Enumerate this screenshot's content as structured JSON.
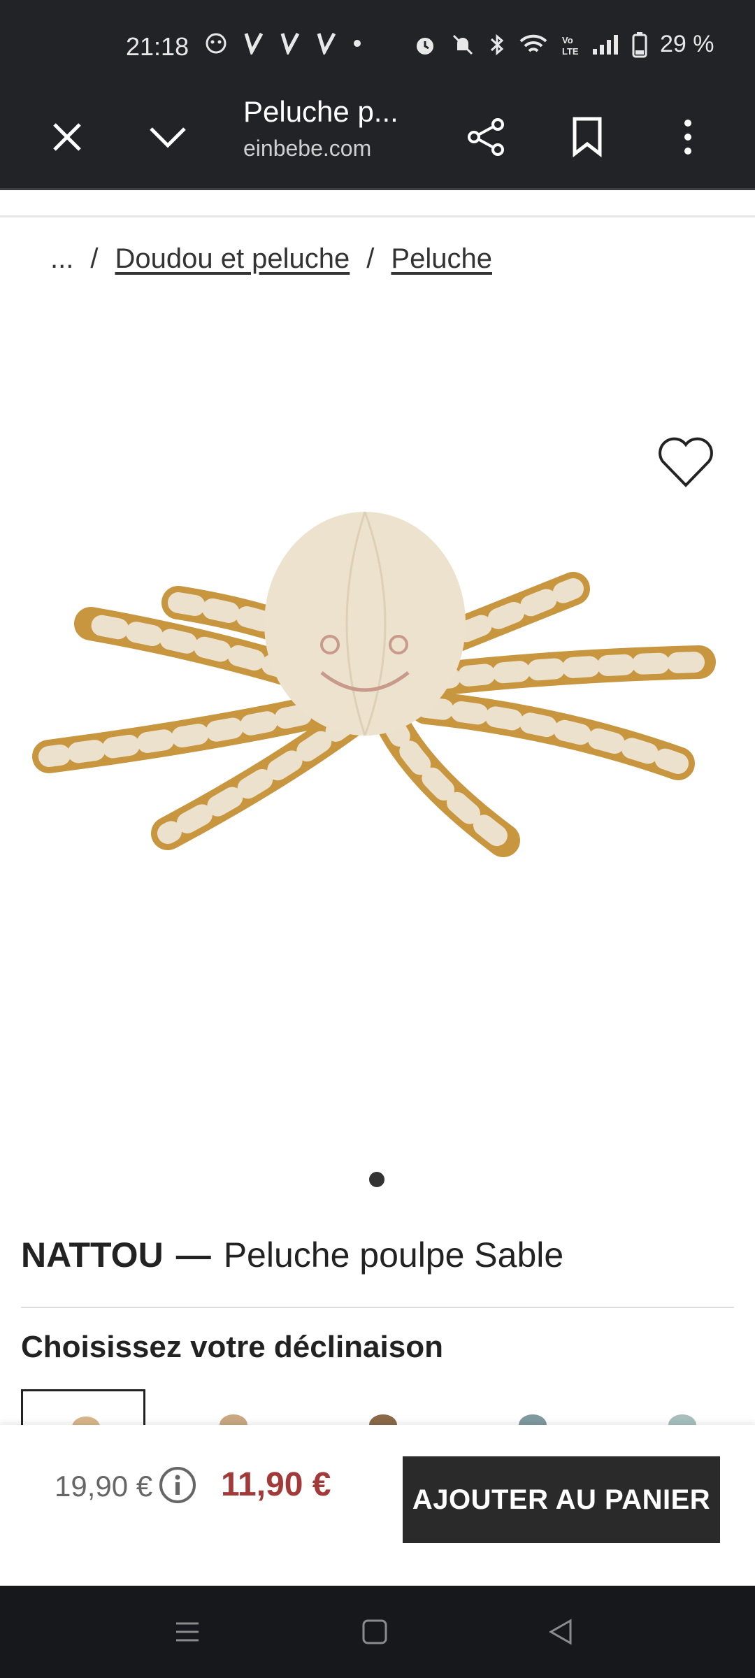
{
  "status_bar": {
    "time": "21:18",
    "battery": "29 %",
    "icons": [
      "app-notification-icon",
      "v-icon",
      "v-icon",
      "v-icon",
      "dot-icon",
      "alarm-icon",
      "mute-icon",
      "bluetooth-icon",
      "wifi-icon",
      "volte-icon",
      "signal-icon",
      "battery-icon"
    ]
  },
  "browser": {
    "title": "Peluche p...",
    "domain": "einbebe.com",
    "buttons": [
      "close-icon",
      "chevron-down-icon",
      "share-icon",
      "bookmark-icon",
      "more-vert-icon"
    ]
  },
  "breadcrumb": {
    "ellipsis": "...",
    "separator": "/",
    "items": [
      "Doudou et peluche",
      "Peluche"
    ]
  },
  "product": {
    "brand": "NATTOU",
    "dash": "—",
    "name": "Peluche poulpe Sable",
    "image_count": 1,
    "active_image": 1
  },
  "variants": {
    "heading": "Choisissez votre déclinaison",
    "swatch_colors": [
      "#d9b58a",
      "#c9a882",
      "#8a6a48",
      "#7f9aa0",
      "#a8bfbd"
    ]
  },
  "cart": {
    "old_price": "19,90 €",
    "new_price": "11,90 €",
    "button_label": "AJOUTER AU PANIER"
  },
  "colors": {
    "chrome": "#212327",
    "price_accent": "#a23a3a",
    "button_bg": "#2a2a2a"
  }
}
